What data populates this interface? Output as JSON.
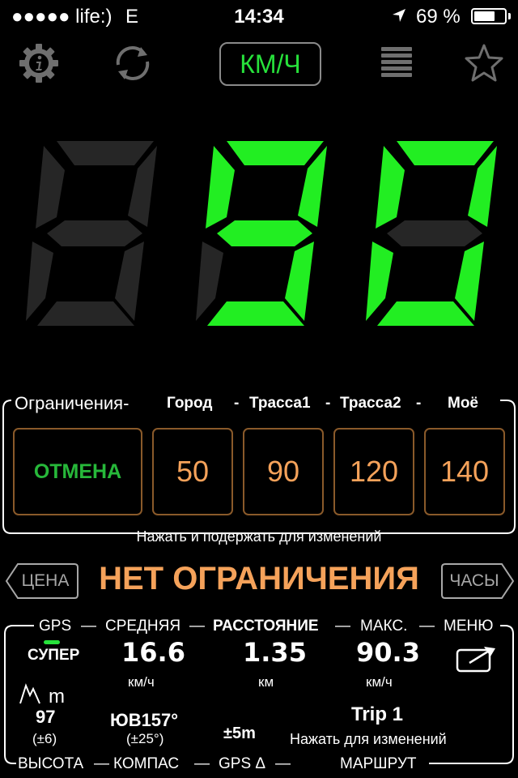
{
  "status_bar": {
    "carrier": "●●●●● life:)",
    "network": "E",
    "time": "14:34",
    "battery_percent": "69 %",
    "battery_level": 0.69
  },
  "toolbar": {
    "unit_label": "КМ/Ч"
  },
  "speed": {
    "value": 90,
    "active_color": "#22ee22",
    "inactive_color": "#262626"
  },
  "limits": {
    "title": "Ограничения-",
    "headers": [
      "Город",
      "-",
      "Трасса1",
      "-",
      "Трасса2",
      "-",
      "Моё"
    ],
    "cancel_label": "ОТМЕНА",
    "values": [
      "50",
      "90",
      "120",
      "140"
    ],
    "hint": "Нажать и подержать для изменений"
  },
  "limit_status": {
    "left_button": "ЦЕНА",
    "text": "НЕТ ОГРАНИЧЕНИЯ",
    "right_button": "ЧАСЫ"
  },
  "stats": {
    "top_labels": {
      "gps": "GPS",
      "dash1": "—",
      "average": "СРЕДНЯЯ",
      "distance": "РАССТОЯНИЕ",
      "dash2": "—",
      "max": "МАКС.",
      "dash3": "—",
      "menu": "МЕНЮ"
    },
    "gps_quality": "СУПЕР",
    "average_value": "16.6",
    "average_unit": "км/ч",
    "distance_value": "1.35",
    "distance_unit": "км",
    "max_value": "90.3",
    "max_unit": "км/ч",
    "altitude_unit": "m",
    "altitude_value": "97",
    "altitude_accuracy": "(±6)",
    "compass_value": "ЮВ157°",
    "compass_accuracy": "(±25°)",
    "gps_delta_value": "±5m",
    "trip_name": "Trip 1",
    "trip_hint": "Нажать для изменений",
    "bottom_labels": {
      "altitude": "ВЫСОТА",
      "compass": "КОМПАС",
      "gps_delta": "GPS Δ",
      "route": "МАРШРУТ"
    }
  }
}
